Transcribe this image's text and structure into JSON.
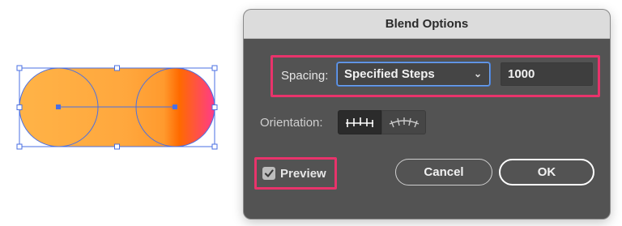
{
  "dialog": {
    "title": "Blend Options",
    "spacing": {
      "label": "Spacing:",
      "selected_option": "Specified Steps",
      "steps_value": "1000"
    },
    "orientation": {
      "label": "Orientation:",
      "options": [
        {
          "name": "align-to-page-icon",
          "selected": true
        },
        {
          "name": "align-to-path-icon",
          "selected": false
        }
      ]
    },
    "preview": {
      "label": "Preview",
      "checked": true
    },
    "buttons": {
      "cancel_label": "Cancel",
      "ok_label": "OK"
    }
  },
  "artwork": {
    "gradient_colors": [
      "#ffb347",
      "#ff9a2e",
      "#ff6a00",
      "#ff3b8a"
    ],
    "selection_color": "#4a6fe3"
  },
  "colors": {
    "highlight": "#e8336b",
    "dialog_bg": "#535353",
    "titlebar_bg": "#dcdcdc"
  }
}
